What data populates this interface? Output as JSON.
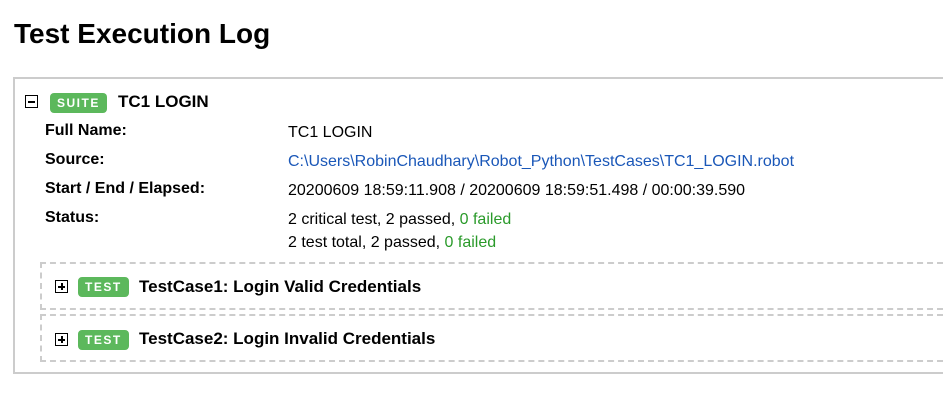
{
  "page": {
    "title": "Test Execution Log"
  },
  "suite": {
    "badge": "SUITE",
    "name": "TC1 LOGIN",
    "meta": {
      "full_name_label": "Full Name:",
      "full_name_value": "TC1 LOGIN",
      "source_label": "Source:",
      "source_value": "C:\\Users\\RobinChaudhary\\Robot_Python\\TestCases\\TC1_LOGIN.robot",
      "times_label": "Start / End / Elapsed:",
      "times_value": "20200609 18:59:11.908 / 20200609 18:59:51.498 / 00:00:39.590",
      "status_label": "Status:",
      "status_line1_prefix": "2 critical test, 2 passed, ",
      "status_line1_failed": "0 failed",
      "status_line2_prefix": "2 test total, 2 passed, ",
      "status_line2_failed": "0 failed"
    }
  },
  "tests": [
    {
      "badge": "TEST",
      "name": "TestCase1: Login Valid Credentials"
    },
    {
      "badge": "TEST",
      "name": "TestCase2: Login Invalid Credentials"
    }
  ],
  "colors": {
    "badge_green": "#5cb85c",
    "link_blue": "#1a57b8",
    "fail_green": "#2a9a2a",
    "border_gray": "#cccccc"
  }
}
